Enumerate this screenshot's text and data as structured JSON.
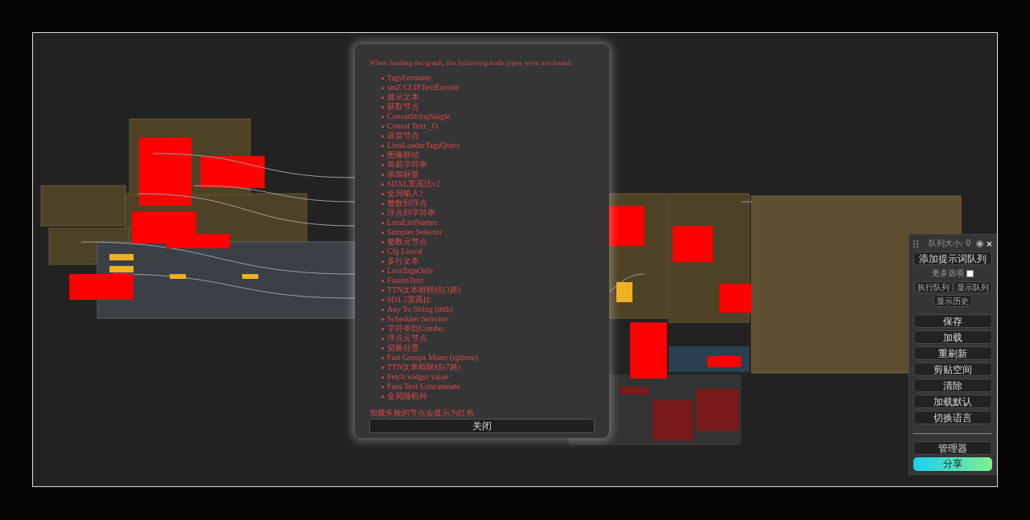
{
  "dialog": {
    "message": "When loading the graph, the following node types were not found:",
    "missing_nodes": [
      "TagsFormater",
      "smZ CLIPTextEncode",
      "展示文本",
      "获取节点",
      "ConcatStringSingle",
      "Concat Text _O",
      "设置节点",
      "LoraLoaderTagsQuery",
      "图像联结",
      "简易字符串",
      "添加标签",
      "SDXL宽高比v2",
      "全局输入?",
      "整数到浮点",
      "浮点到字符串",
      "LoraListNames",
      "Sampler Selector",
      "整数元节点",
      "Cfg Literal",
      "多行文本",
      "LoraTagsOnly",
      "FusionText",
      "TTN文本框联结(3路)",
      "SD1.5宽高比",
      "Any To String (mtb)",
      "Scheduler Selector",
      "字符串到Combo",
      "浮点元节点",
      "切换任意",
      "Fast Groups Muter (rgthree)",
      "TTN文本框联结(7路)",
      "Fetch widget value",
      "Fans Text Concatenate",
      "全局随机种"
    ],
    "note": "加载失败的节点会显示为红色",
    "close_button": "关闭"
  },
  "queue_panel": {
    "title": "队列大小: 0",
    "add_button": "添加提示词队列",
    "more_options": {
      "label": "更多选项",
      "checked": false
    },
    "small_buttons": [
      "执行队列",
      "显示队列",
      "显示历史"
    ],
    "buttons": [
      "保存",
      "加载",
      "重刷新",
      "剪贴空间",
      "清除",
      "加载默认",
      "切换语言"
    ],
    "manager_button": "管理器",
    "share_button": "分享"
  }
}
